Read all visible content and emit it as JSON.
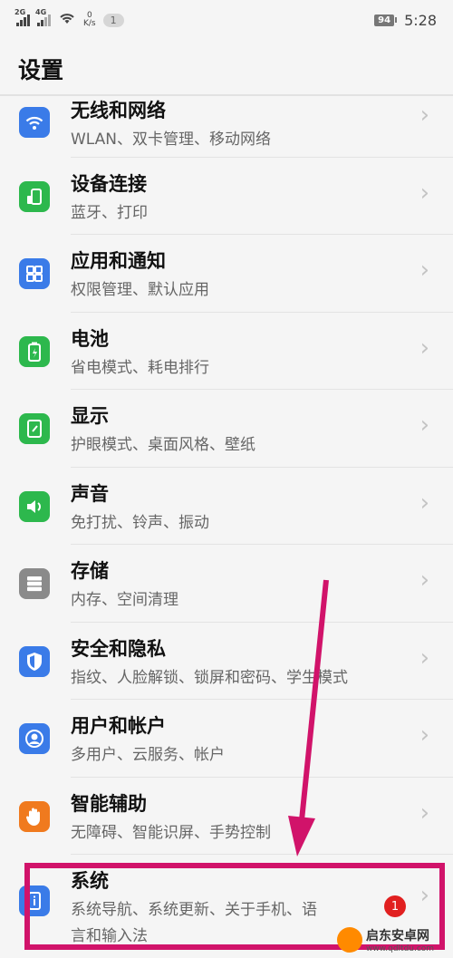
{
  "status": {
    "signal1": "2G",
    "signal2": "4G",
    "speed_value": "0",
    "speed_unit": "K/s",
    "notification_count": "1",
    "battery": "94",
    "time": "5:28"
  },
  "page": {
    "title": "设置"
  },
  "items": [
    {
      "title": "无线和网络",
      "sub": "WLAN、双卡管理、移动网络",
      "icon": "wifi-icon",
      "color": "#3a7be8"
    },
    {
      "title": "设备连接",
      "sub": "蓝牙、打印",
      "icon": "device-connect-icon",
      "color": "#2db84d"
    },
    {
      "title": "应用和通知",
      "sub": "权限管理、默认应用",
      "icon": "apps-grid-icon",
      "color": "#3a7be8"
    },
    {
      "title": "电池",
      "sub": "省电模式、耗电排行",
      "icon": "battery-icon",
      "color": "#2db84d"
    },
    {
      "title": "显示",
      "sub": "护眼模式、桌面风格、壁纸",
      "icon": "display-icon",
      "color": "#2db84d"
    },
    {
      "title": "声音",
      "sub": "免打扰、铃声、振动",
      "icon": "sound-icon",
      "color": "#2db84d"
    },
    {
      "title": "存储",
      "sub": "内存、空间清理",
      "icon": "storage-icon",
      "color": "#8a8a8a"
    },
    {
      "title": "安全和隐私",
      "sub": "指纹、人脸解锁、锁屏和密码、学生模式",
      "icon": "shield-icon",
      "color": "#3a7be8"
    },
    {
      "title": "用户和帐户",
      "sub": "多用户、云服务、帐户",
      "icon": "user-icon",
      "color": "#3a7be8"
    },
    {
      "title": "智能辅助",
      "sub": "无障碍、智能识屏、手势控制",
      "icon": "hand-icon",
      "color": "#f07a1e"
    },
    {
      "title": "系统",
      "sub": "系统导航、系统更新、关于手机、语",
      "sub2": "言和输入法",
      "icon": "system-info-icon",
      "color": "#3a7be8",
      "badge": "1"
    }
  ],
  "watermark": {
    "name": "启东安卓网",
    "url": "www.qdltdu.com"
  }
}
